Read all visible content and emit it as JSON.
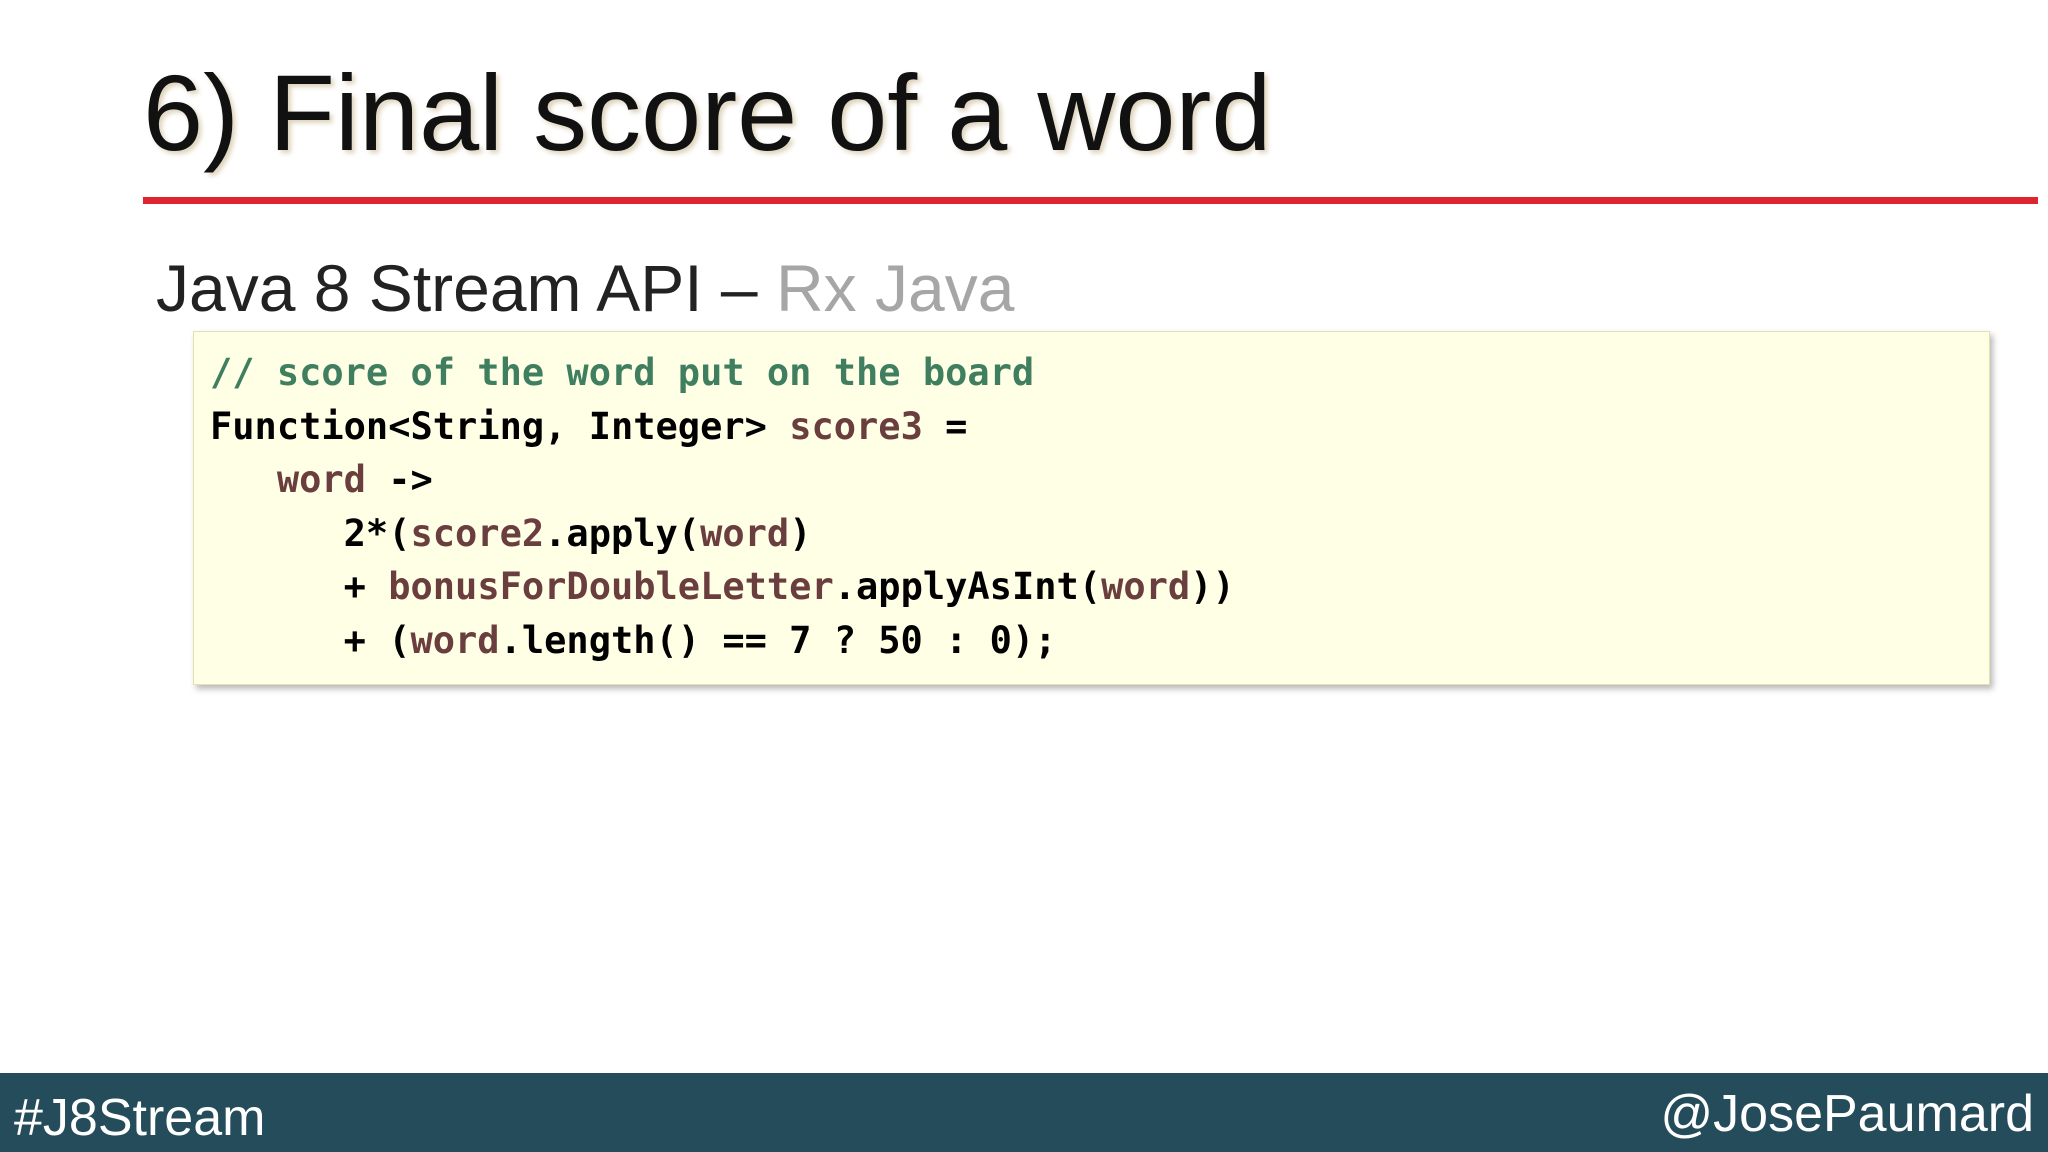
{
  "slide": {
    "title": "6) Final score of a word",
    "subtitle": {
      "main": "Java 8 Stream API – ",
      "muted": "Rx Java"
    },
    "code": {
      "line1": {
        "comment": "// score of the word put on the board"
      },
      "line2": {
        "a": "Function<String, Integer> ",
        "b": "score3",
        "c": " ="
      },
      "line3": {
        "indent": "   ",
        "a": "word",
        "b": " ->"
      },
      "line4": {
        "indent": "      ",
        "a": "2*(",
        "b": "score2",
        "c": ".apply(",
        "d": "word",
        "e": ")"
      },
      "line5": {
        "indent": "      ",
        "a": "+ ",
        "b": "bonusForDoubleLetter",
        "c": ".applyAsInt(",
        "d": "word",
        "e": "))"
      },
      "line6": {
        "indent": "      ",
        "a": "+ (",
        "b": "word",
        "c": ".length() == 7 ? 50 : 0);"
      }
    },
    "colors": {
      "accent_rule": "#e0242f",
      "code_background": "#ffffe6",
      "code_comment": "#3f7f5f",
      "code_variable": "#6a3e3e",
      "footer_background": "#254c5a"
    }
  },
  "footer": {
    "left": "#J8Stream",
    "right": "@JosePaumard"
  }
}
